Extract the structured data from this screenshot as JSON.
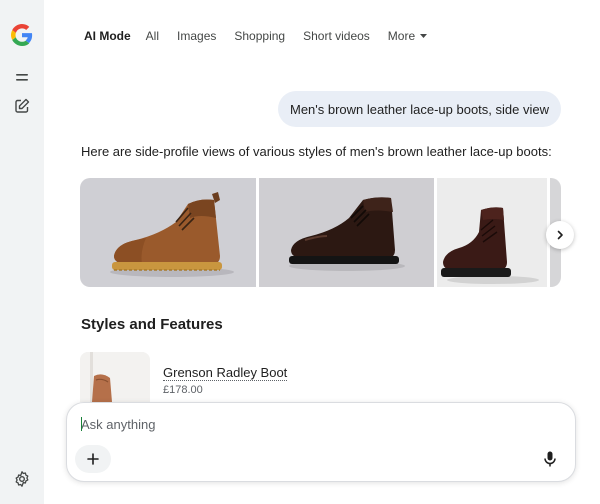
{
  "nav": {
    "tabs": [
      {
        "label": "AI Mode",
        "active": true
      },
      {
        "label": "All"
      },
      {
        "label": "Images"
      },
      {
        "label": "Shopping"
      },
      {
        "label": "Short videos"
      },
      {
        "label": "More"
      }
    ]
  },
  "sidebar": {
    "icons": [
      "google-logo",
      "menu-icon",
      "new-chat-icon",
      "settings-icon"
    ]
  },
  "conversation": {
    "query": "Men's brown leather lace-up boots, side view",
    "answer_intro": "Here are side-profile views of various styles of men's brown leather lace-up boots:"
  },
  "gallery": {
    "images": [
      "brown-cap-toe-boot",
      "dark-brown-boot",
      "dark-oxblood-boot",
      "partial-boot"
    ],
    "next_icon": "chevron-right-icon"
  },
  "section": {
    "title": "Styles and Features"
  },
  "product": {
    "name": "Grenson Radley Boot",
    "price": "£178.00"
  },
  "composer": {
    "placeholder": "Ask anything",
    "plus_icon": "plus-icon",
    "mic_icon": "mic-icon"
  },
  "colors": {
    "sidebar_bg": "#f1f3f4",
    "query_bubble": "#e9eef6",
    "text": "#1f1f1f",
    "muted": "#5f6368"
  }
}
